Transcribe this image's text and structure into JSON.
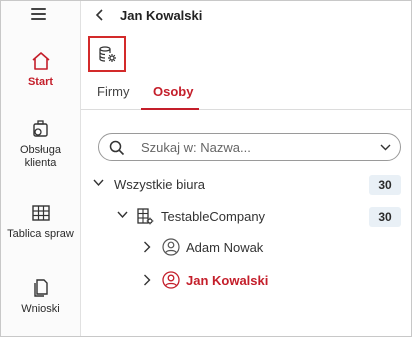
{
  "header": {
    "title": "Jan Kowalski"
  },
  "sidebar": {
    "items": [
      {
        "label": "Start",
        "icon": "home-icon",
        "active": true
      },
      {
        "label": "Obsługa klienta",
        "icon": "customer-service-icon",
        "active": false
      },
      {
        "label": "Tablica spraw",
        "icon": "table-icon",
        "active": false
      },
      {
        "label": "Wnioski",
        "icon": "document-icon",
        "active": false
      }
    ]
  },
  "toolbar": {
    "db_icon": "database-settings-icon"
  },
  "tabs": [
    {
      "label": "Firmy",
      "active": false
    },
    {
      "label": "Osoby",
      "active": true
    }
  ],
  "search": {
    "placeholder": "Szukaj w: Nazwa..."
  },
  "tree": {
    "root": {
      "label": "Wszystkie biura",
      "count": "30"
    },
    "company": {
      "label": "TestableCompany",
      "count": "30"
    },
    "people": [
      {
        "label": "Adam Nowak",
        "selected": false
      },
      {
        "label": "Jan Kowalski",
        "selected": true
      }
    ]
  },
  "colors": {
    "accent": "#c41e2a",
    "badge_bg": "#e9f0f6",
    "highlight_border": "#d32a2a"
  }
}
